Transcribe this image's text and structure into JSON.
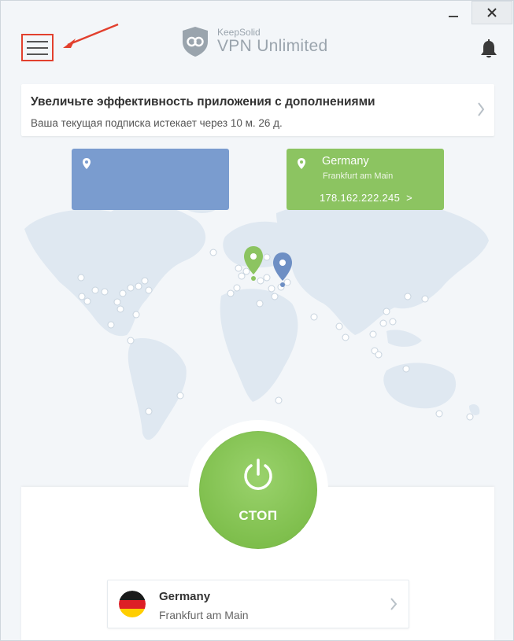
{
  "app": {
    "brand_small": "KeepSolid",
    "brand_name": "VPN Unlimited"
  },
  "icons": {
    "menu": "hamburger-icon",
    "notifications": "bell-icon",
    "close": "close-icon",
    "minimize": "minimize-icon",
    "power": "power-icon"
  },
  "promo": {
    "title": "Увеличьте эффективность приложения с дополнениями",
    "subtitle": "Ваша текущая подписка истекает через 10 м. 26 д."
  },
  "connection": {
    "from": {},
    "to": {
      "country": "Germany",
      "city": "Frankfurt am Main",
      "ip": "178.162.222.245",
      "chevron": ">"
    }
  },
  "power_button": {
    "label": "СТОП"
  },
  "server": {
    "country": "Germany",
    "city": "Frankfurt am Main"
  },
  "colors": {
    "accent_green": "#8cc461",
    "origin_blue": "#7a9ccf",
    "highlight_red": "#e2402e"
  }
}
